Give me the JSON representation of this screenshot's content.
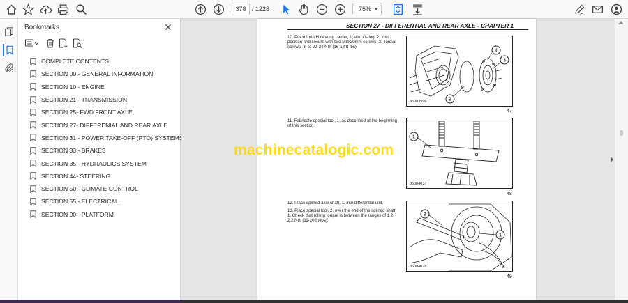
{
  "toolbar": {
    "current_page": "378",
    "page_count_label": "/  1228",
    "zoom": "75%"
  },
  "bookmarks": {
    "title": "Bookmarks",
    "close_glyph": "✕",
    "items": [
      {
        "label": "COMPLETE CONTENTS"
      },
      {
        "label": "SECTION 00 - GENERAL INFORMATION"
      },
      {
        "label": "SECTION 10 - ENGINE"
      },
      {
        "label": "SECTION 21 - TRANSMISSION"
      },
      {
        "label": "SECTION 25- FWD FRONT AXLE"
      },
      {
        "label": "SECTION 27- DIFFERENIAL AND REAR AXLE"
      },
      {
        "label": "SECTION 31 - POWER TAKE-OFF (PTO) SYSTEMS"
      },
      {
        "label": "SECTION 33 - BRAKES"
      },
      {
        "label": "SECTION 35 - HYDRAULICS SYSTEM"
      },
      {
        "label": "SECTION 44- STEERING"
      },
      {
        "label": "SECTION 50 - CLIMATE CONTROL"
      },
      {
        "label": "SECTION 55 - ELECTRICAL"
      },
      {
        "label": "SECTION 90 - PLATFORM"
      }
    ]
  },
  "document": {
    "section_header": "SECTION 27 - DIFFERENTIAL AND REAR AXLE - CHAPTER 1",
    "steps": {
      "s10": "10. Place the LH bearing carrier, 1, and O-ring, 2, into position and secure with two M8x20mm screws, 3. Torque screws, 3, to 22-24 Nm (16-18 ft-lbs).",
      "s11": "11. Fabricate special tool, 1, as described at the beginning of this section.",
      "s12": "12. Place splined axle shaft, 1, into differential unit.",
      "s13": "13. Place special tool, 2, over the end of the splined shaft, 1. Check that rolling torque is between the ranges of 1.2-2.2 Nm (11-20 in-lbs)."
    },
    "figures": [
      {
        "code": "36083996",
        "number": "47",
        "callouts": [
          "1",
          "2",
          "3"
        ]
      },
      {
        "code": "86084037",
        "number": "48",
        "callouts": [
          "1"
        ]
      },
      {
        "code": "86084028",
        "number": "49",
        "callouts": [
          "1",
          "2"
        ]
      }
    ],
    "watermark": "machinecatalogic.com"
  },
  "colors": {
    "accent": "#1473e6",
    "watermark": "#ffd700",
    "viewer_background": "#e5e5e5"
  }
}
